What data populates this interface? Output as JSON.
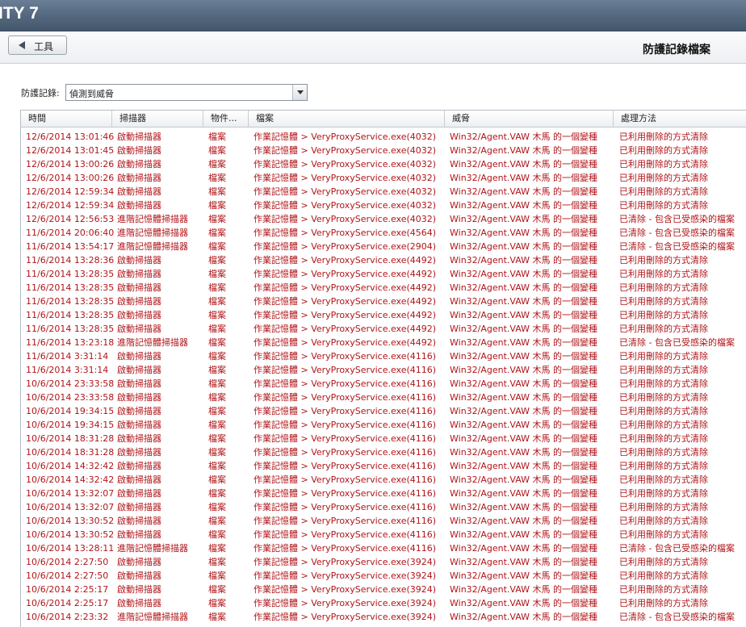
{
  "app": {
    "brand": "ITY 7"
  },
  "toolbar": {
    "back_label": "工具",
    "page_title": "防護記錄檔案"
  },
  "filter": {
    "label": "防護記錄:",
    "selected": "偵測到威脅"
  },
  "columns": [
    "時間",
    "掃描器",
    "物件...",
    "檔案",
    "威脅",
    "處理方法"
  ],
  "rows": [
    {
      "time": "12/6/2014 13:01:46",
      "scanner": "啟動掃描器",
      "obj": "檔案",
      "file": "作業記憶體 > VeryProxyService.exe(4032)",
      "threat": "Win32/Agent.VAW 木馬 的一個變種",
      "action": "已利用刪除的方式清除"
    },
    {
      "time": "12/6/2014 13:01:45",
      "scanner": "啟動掃描器",
      "obj": "檔案",
      "file": "作業記憶體 > VeryProxyService.exe(4032)",
      "threat": "Win32/Agent.VAW 木馬 的一個變種",
      "action": "已利用刪除的方式清除"
    },
    {
      "time": "12/6/2014 13:00:26",
      "scanner": "啟動掃描器",
      "obj": "檔案",
      "file": "作業記憶體 > VeryProxyService.exe(4032)",
      "threat": "Win32/Agent.VAW 木馬 的一個變種",
      "action": "已利用刪除的方式清除"
    },
    {
      "time": "12/6/2014 13:00:26",
      "scanner": "啟動掃描器",
      "obj": "檔案",
      "file": "作業記憶體 > VeryProxyService.exe(4032)",
      "threat": "Win32/Agent.VAW 木馬 的一個變種",
      "action": "已利用刪除的方式清除"
    },
    {
      "time": "12/6/2014 12:59:34",
      "scanner": "啟動掃描器",
      "obj": "檔案",
      "file": "作業記憶體 > VeryProxyService.exe(4032)",
      "threat": "Win32/Agent.VAW 木馬 的一個變種",
      "action": "已利用刪除的方式清除"
    },
    {
      "time": "12/6/2014 12:59:34",
      "scanner": "啟動掃描器",
      "obj": "檔案",
      "file": "作業記憶體 > VeryProxyService.exe(4032)",
      "threat": "Win32/Agent.VAW 木馬 的一個變種",
      "action": "已利用刪除的方式清除"
    },
    {
      "time": "12/6/2014 12:56:53",
      "scanner": "進階記憶體掃描器",
      "obj": "檔案",
      "file": "作業記憶體 > VeryProxyService.exe(4032)",
      "threat": "Win32/Agent.VAW 木馬 的一個變種",
      "action": "已清除 - 包含已受感染的檔案"
    },
    {
      "time": "11/6/2014 20:06:40",
      "scanner": "進階記憶體掃描器",
      "obj": "檔案",
      "file": "作業記憶體 > VeryProxyService.exe(4564)",
      "threat": "Win32/Agent.VAW 木馬 的一個變種",
      "action": "已清除 - 包含已受感染的檔案"
    },
    {
      "time": "11/6/2014 13:54:17",
      "scanner": "進階記憶體掃描器",
      "obj": "檔案",
      "file": "作業記憶體 > VeryProxyService.exe(2904)",
      "threat": "Win32/Agent.VAW 木馬 的一個變種",
      "action": "已清除 - 包含已受感染的檔案"
    },
    {
      "time": "11/6/2014 13:28:36",
      "scanner": "啟動掃描器",
      "obj": "檔案",
      "file": "作業記憶體 > VeryProxyService.exe(4492)",
      "threat": "Win32/Agent.VAW 木馬 的一個變種",
      "action": "已利用刪除的方式清除"
    },
    {
      "time": "11/6/2014 13:28:35",
      "scanner": "啟動掃描器",
      "obj": "檔案",
      "file": "作業記憶體 > VeryProxyService.exe(4492)",
      "threat": "Win32/Agent.VAW 木馬 的一個變種",
      "action": "已利用刪除的方式清除"
    },
    {
      "time": "11/6/2014 13:28:35",
      "scanner": "啟動掃描器",
      "obj": "檔案",
      "file": "作業記憶體 > VeryProxyService.exe(4492)",
      "threat": "Win32/Agent.VAW 木馬 的一個變種",
      "action": "已利用刪除的方式清除"
    },
    {
      "time": "11/6/2014 13:28:35",
      "scanner": "啟動掃描器",
      "obj": "檔案",
      "file": "作業記憶體 > VeryProxyService.exe(4492)",
      "threat": "Win32/Agent.VAW 木馬 的一個變種",
      "action": "已利用刪除的方式清除"
    },
    {
      "time": "11/6/2014 13:28:35",
      "scanner": "啟動掃描器",
      "obj": "檔案",
      "file": "作業記憶體 > VeryProxyService.exe(4492)",
      "threat": "Win32/Agent.VAW 木馬 的一個變種",
      "action": "已利用刪除的方式清除"
    },
    {
      "time": "11/6/2014 13:28:35",
      "scanner": "啟動掃描器",
      "obj": "檔案",
      "file": "作業記憶體 > VeryProxyService.exe(4492)",
      "threat": "Win32/Agent.VAW 木馬 的一個變種",
      "action": "已利用刪除的方式清除"
    },
    {
      "time": "11/6/2014 13:23:18",
      "scanner": "進階記憶體掃描器",
      "obj": "檔案",
      "file": "作業記憶體 > VeryProxyService.exe(4492)",
      "threat": "Win32/Agent.VAW 木馬 的一個變種",
      "action": "已清除 - 包含已受感染的檔案"
    },
    {
      "time": "11/6/2014 3:31:14",
      "scanner": "啟動掃描器",
      "obj": "檔案",
      "file": "作業記憶體 > VeryProxyService.exe(4116)",
      "threat": "Win32/Agent.VAW 木馬 的一個變種",
      "action": "已利用刪除的方式清除"
    },
    {
      "time": "11/6/2014 3:31:14",
      "scanner": "啟動掃描器",
      "obj": "檔案",
      "file": "作業記憶體 > VeryProxyService.exe(4116)",
      "threat": "Win32/Agent.VAW 木馬 的一個變種",
      "action": "已利用刪除的方式清除"
    },
    {
      "time": "10/6/2014 23:33:58",
      "scanner": "啟動掃描器",
      "obj": "檔案",
      "file": "作業記憶體 > VeryProxyService.exe(4116)",
      "threat": "Win32/Agent.VAW 木馬 的一個變種",
      "action": "已利用刪除的方式清除"
    },
    {
      "time": "10/6/2014 23:33:58",
      "scanner": "啟動掃描器",
      "obj": "檔案",
      "file": "作業記憶體 > VeryProxyService.exe(4116)",
      "threat": "Win32/Agent.VAW 木馬 的一個變種",
      "action": "已利用刪除的方式清除"
    },
    {
      "time": "10/6/2014 19:34:15",
      "scanner": "啟動掃描器",
      "obj": "檔案",
      "file": "作業記憶體 > VeryProxyService.exe(4116)",
      "threat": "Win32/Agent.VAW 木馬 的一個變種",
      "action": "已利用刪除的方式清除"
    },
    {
      "time": "10/6/2014 19:34:15",
      "scanner": "啟動掃描器",
      "obj": "檔案",
      "file": "作業記憶體 > VeryProxyService.exe(4116)",
      "threat": "Win32/Agent.VAW 木馬 的一個變種",
      "action": "已利用刪除的方式清除"
    },
    {
      "time": "10/6/2014 18:31:28",
      "scanner": "啟動掃描器",
      "obj": "檔案",
      "file": "作業記憶體 > VeryProxyService.exe(4116)",
      "threat": "Win32/Agent.VAW 木馬 的一個變種",
      "action": "已利用刪除的方式清除"
    },
    {
      "time": "10/6/2014 18:31:28",
      "scanner": "啟動掃描器",
      "obj": "檔案",
      "file": "作業記憶體 > VeryProxyService.exe(4116)",
      "threat": "Win32/Agent.VAW 木馬 的一個變種",
      "action": "已利用刪除的方式清除"
    },
    {
      "time": "10/6/2014 14:32:42",
      "scanner": "啟動掃描器",
      "obj": "檔案",
      "file": "作業記憶體 > VeryProxyService.exe(4116)",
      "threat": "Win32/Agent.VAW 木馬 的一個變種",
      "action": "已利用刪除的方式清除"
    },
    {
      "time": "10/6/2014 14:32:42",
      "scanner": "啟動掃描器",
      "obj": "檔案",
      "file": "作業記憶體 > VeryProxyService.exe(4116)",
      "threat": "Win32/Agent.VAW 木馬 的一個變種",
      "action": "已利用刪除的方式清除"
    },
    {
      "time": "10/6/2014 13:32:07",
      "scanner": "啟動掃描器",
      "obj": "檔案",
      "file": "作業記憶體 > VeryProxyService.exe(4116)",
      "threat": "Win32/Agent.VAW 木馬 的一個變種",
      "action": "已利用刪除的方式清除"
    },
    {
      "time": "10/6/2014 13:32:07",
      "scanner": "啟動掃描器",
      "obj": "檔案",
      "file": "作業記憶體 > VeryProxyService.exe(4116)",
      "threat": "Win32/Agent.VAW 木馬 的一個變種",
      "action": "已利用刪除的方式清除"
    },
    {
      "time": "10/6/2014 13:30:52",
      "scanner": "啟動掃描器",
      "obj": "檔案",
      "file": "作業記憶體 > VeryProxyService.exe(4116)",
      "threat": "Win32/Agent.VAW 木馬 的一個變種",
      "action": "已利用刪除的方式清除"
    },
    {
      "time": "10/6/2014 13:30:52",
      "scanner": "啟動掃描器",
      "obj": "檔案",
      "file": "作業記憶體 > VeryProxyService.exe(4116)",
      "threat": "Win32/Agent.VAW 木馬 的一個變種",
      "action": "已利用刪除的方式清除"
    },
    {
      "time": "10/6/2014 13:28:11",
      "scanner": "進階記憶體掃描器",
      "obj": "檔案",
      "file": "作業記憶體 > VeryProxyService.exe(4116)",
      "threat": "Win32/Agent.VAW 木馬 的一個變種",
      "action": "已清除 - 包含已受感染的檔案"
    },
    {
      "time": "10/6/2014 2:27:50",
      "scanner": "啟動掃描器",
      "obj": "檔案",
      "file": "作業記憶體 > VeryProxyService.exe(3924)",
      "threat": "Win32/Agent.VAW 木馬 的一個變種",
      "action": "已利用刪除的方式清除"
    },
    {
      "time": "10/6/2014 2:27:50",
      "scanner": "啟動掃描器",
      "obj": "檔案",
      "file": "作業記憶體 > VeryProxyService.exe(3924)",
      "threat": "Win32/Agent.VAW 木馬 的一個變種",
      "action": "已利用刪除的方式清除"
    },
    {
      "time": "10/6/2014 2:25:17",
      "scanner": "啟動掃描器",
      "obj": "檔案",
      "file": "作業記憶體 > VeryProxyService.exe(3924)",
      "threat": "Win32/Agent.VAW 木馬 的一個變種",
      "action": "已利用刪除的方式清除"
    },
    {
      "time": "10/6/2014 2:25:17",
      "scanner": "啟動掃描器",
      "obj": "檔案",
      "file": "作業記憶體 > VeryProxyService.exe(3924)",
      "threat": "Win32/Agent.VAW 木馬 的一個變種",
      "action": "已利用刪除的方式清除"
    },
    {
      "time": "10/6/2014 2:23:32",
      "scanner": "進階記憶體掃描器",
      "obj": "檔案",
      "file": "作業記憶體 > VeryProxyService.exe(3924)",
      "threat": "Win32/Agent.VAW 木馬 的一個變種",
      "action": "已清除 - 包含已受感染的檔案"
    }
  ]
}
